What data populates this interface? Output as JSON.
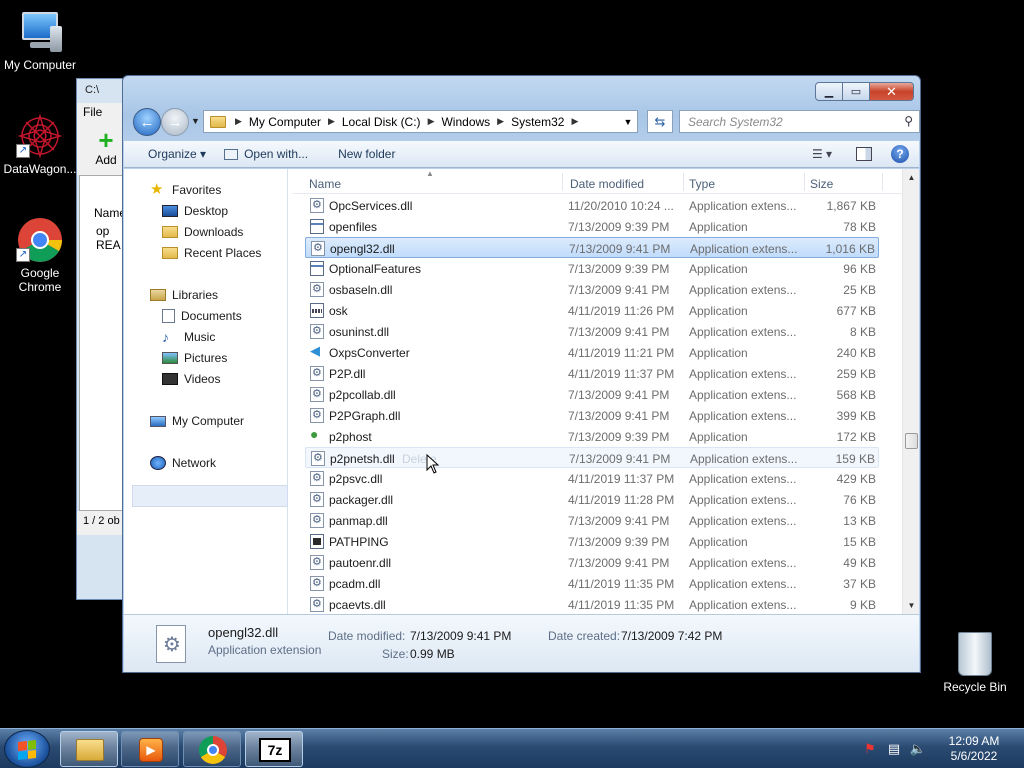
{
  "desktop": {
    "icons": [
      {
        "label": "My Computer"
      },
      {
        "label": "DataWagon..."
      },
      {
        "label": "Google Chrome"
      },
      {
        "label": "Recycle Bin"
      }
    ]
  },
  "bg_window": {
    "title": "C:\\",
    "menu_file": "File",
    "add_label": "Add",
    "col_name": "Name",
    "items": [
      "op",
      "REA"
    ],
    "status": "1 / 2 ob"
  },
  "window": {
    "breadcrumbs": [
      "My Computer",
      "Local Disk (C:)",
      "Windows",
      "System32"
    ],
    "search_placeholder": "Search System32",
    "toolbar": {
      "organize": "Organize",
      "open_with": "Open with...",
      "new_folder": "New folder"
    },
    "nav": {
      "favorites": "Favorites",
      "desktop": "Desktop",
      "downloads": "Downloads",
      "recent": "Recent Places",
      "libraries": "Libraries",
      "documents": "Documents",
      "music": "Music",
      "pictures": "Pictures",
      "videos": "Videos",
      "computer": "My Computer",
      "network": "Network"
    },
    "columns": {
      "name": "Name",
      "date": "Date modified",
      "type": "Type",
      "size": "Size"
    },
    "files": [
      {
        "name": "OpcServices.dll",
        "date": "11/20/2010 10:24 ...",
        "type": "Application extens...",
        "size": "1,867 KB",
        "icon": "dll"
      },
      {
        "name": "openfiles",
        "date": "7/13/2009 9:39 PM",
        "type": "Application",
        "size": "78 KB",
        "icon": "app"
      },
      {
        "name": "opengl32.dll",
        "date": "7/13/2009 9:41 PM",
        "type": "Application extens...",
        "size": "1,016 KB",
        "icon": "dll"
      },
      {
        "name": "OptionalFeatures",
        "date": "7/13/2009 9:39 PM",
        "type": "Application",
        "size": "96 KB",
        "icon": "app"
      },
      {
        "name": "osbaseln.dll",
        "date": "7/13/2009 9:41 PM",
        "type": "Application extens...",
        "size": "25 KB",
        "icon": "dll"
      },
      {
        "name": "osk",
        "date": "4/11/2019 11:26 PM",
        "type": "Application",
        "size": "677 KB",
        "icon": "kbd"
      },
      {
        "name": "osuninst.dll",
        "date": "7/13/2009 9:41 PM",
        "type": "Application extens...",
        "size": "8 KB",
        "icon": "dll"
      },
      {
        "name": "OxpsConverter",
        "date": "4/11/2019 11:21 PM",
        "type": "Application",
        "size": "240 KB",
        "icon": "oxps"
      },
      {
        "name": "P2P.dll",
        "date": "4/11/2019 11:37 PM",
        "type": "Application extens...",
        "size": "259 KB",
        "icon": "dll"
      },
      {
        "name": "p2pcollab.dll",
        "date": "7/13/2009 9:41 PM",
        "type": "Application extens...",
        "size": "568 KB",
        "icon": "dll"
      },
      {
        "name": "P2PGraph.dll",
        "date": "7/13/2009 9:41 PM",
        "type": "Application extens...",
        "size": "399 KB",
        "icon": "dll"
      },
      {
        "name": "p2phost",
        "date": "7/13/2009 9:39 PM",
        "type": "Application",
        "size": "172 KB",
        "icon": "p2p"
      },
      {
        "name": "p2pnetsh.dll",
        "date": "7/13/2009 9:41 PM",
        "type": "Application extens...",
        "size": "159 KB",
        "icon": "dll"
      },
      {
        "name": "p2psvc.dll",
        "date": "4/11/2019 11:37 PM",
        "type": "Application extens...",
        "size": "429 KB",
        "icon": "dll"
      },
      {
        "name": "packager.dll",
        "date": "4/11/2019 11:28 PM",
        "type": "Application extens...",
        "size": "76 KB",
        "icon": "dll"
      },
      {
        "name": "panmap.dll",
        "date": "7/13/2009 9:41 PM",
        "type": "Application extens...",
        "size": "13 KB",
        "icon": "dll"
      },
      {
        "name": "PATHPING",
        "date": "7/13/2009 9:39 PM",
        "type": "Application",
        "size": "15 KB",
        "icon": "cmd"
      },
      {
        "name": "pautoenr.dll",
        "date": "7/13/2009 9:41 PM",
        "type": "Application extens...",
        "size": "49 KB",
        "icon": "dll"
      },
      {
        "name": "pcadm.dll",
        "date": "4/11/2019 11:35 PM",
        "type": "Application extens...",
        "size": "37 KB",
        "icon": "dll"
      },
      {
        "name": "pcaevts.dll",
        "date": "4/11/2019 11:35 PM",
        "type": "Application extens...",
        "size": "9 KB",
        "icon": "dll"
      }
    ],
    "ghost_label": "Delete",
    "details": {
      "name": "opengl32.dll",
      "type": "Application extension",
      "modified_label": "Date modified:",
      "modified": "7/13/2009 9:41 PM",
      "created_label": "Date created:",
      "created": "7/13/2009 7:42 PM",
      "size_label": "Size:",
      "size": "0.99 MB"
    }
  },
  "taskbar": {
    "time": "12:09 AM",
    "date": "5/6/2022",
    "sevenzip_label": "7z"
  }
}
